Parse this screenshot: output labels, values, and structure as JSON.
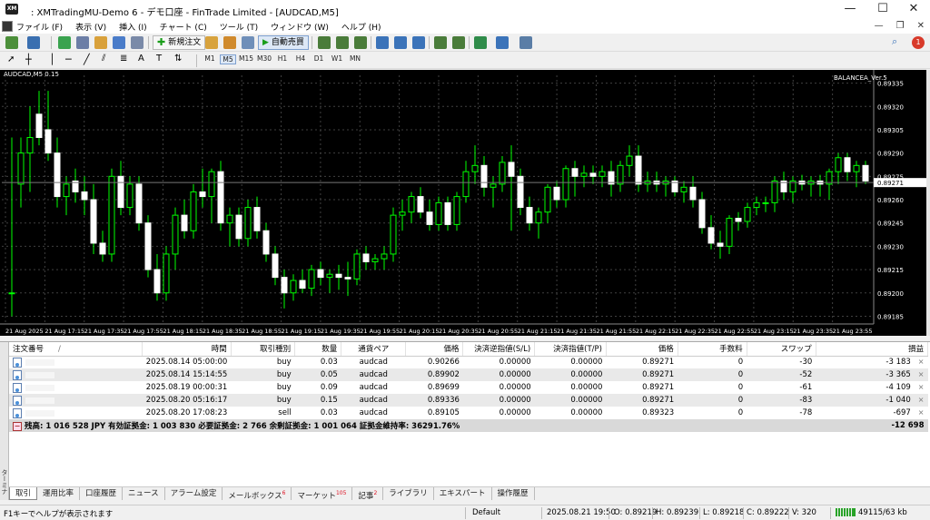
{
  "window": {
    "title": ": XMTradingMU-Demo 6 - デモ口座 - FinTrade Limited - [AUDCAD,M5]",
    "app_icon": "XM",
    "minimize": "—",
    "maximize": "☐",
    "close": "✕"
  },
  "menu": {
    "items": [
      "ファイル (F)",
      "表示 (V)",
      "挿入 (I)",
      "チャート (C)",
      "ツール (T)",
      "ウィンドウ (W)",
      "ヘルプ (H)"
    ],
    "right": [
      "—",
      "❐",
      "✕"
    ]
  },
  "toolbar": {
    "new_order_label": "新規注文",
    "auto_trade_label": "自動売買",
    "timeframes": [
      "M1",
      "M5",
      "M15",
      "M30",
      "H1",
      "H4",
      "D1",
      "W1",
      "MN"
    ],
    "notification_count": "1"
  },
  "chart": {
    "symbol_label": "AUDCAD,M5 0.15",
    "ea_label": "BALANCEA_Ver.5",
    "current_price": "0.89271",
    "colors": {
      "bg": "#000000",
      "bull": "#ffffff",
      "bear": "#00ff00",
      "grid": "#404040",
      "text": "#ffffff"
    }
  },
  "chart_data": {
    "type": "candlestick",
    "symbol": "AUDCAD",
    "timeframe": "M5",
    "ylim": [
      0.8918,
      0.8934
    ],
    "y_ticks": [
      "0.89335",
      "0.89320",
      "0.89305",
      "0.89290",
      "0.89275",
      "0.89260",
      "0.89245",
      "0.89230",
      "0.89215",
      "0.89200",
      "0.89185"
    ],
    "y_tick_values": [
      0.89335,
      0.8932,
      0.89305,
      0.8929,
      0.89275,
      0.8926,
      0.89245,
      0.8923,
      0.89215,
      0.892,
      0.89185
    ],
    "x_ticks": [
      "21 Aug 2025",
      "21 Aug 17:15",
      "21 Aug 17:35",
      "21 Aug 17:55",
      "21 Aug 18:15",
      "21 Aug 18:35",
      "21 Aug 18:55",
      "21 Aug 19:15",
      "21 Aug 19:35",
      "21 Aug 19:55",
      "21 Aug 20:15",
      "21 Aug 20:35",
      "21 Aug 20:55",
      "21 Aug 21:15",
      "21 Aug 21:35",
      "21 Aug 21:55",
      "21 Aug 22:15",
      "21 Aug 22:35",
      "21 Aug 22:55",
      "21 Aug 23:15",
      "21 Aug 23:35",
      "21 Aug 23:55"
    ],
    "bid_line": 0.89271,
    "grid": true,
    "candles": [
      {
        "o": 0.892,
        "h": 0.893,
        "l": 0.89185,
        "c": 0.892
      },
      {
        "o": 0.8927,
        "h": 0.893,
        "l": 0.89255,
        "c": 0.8929
      },
      {
        "o": 0.8929,
        "h": 0.8932,
        "l": 0.89265,
        "c": 0.893
      },
      {
        "o": 0.89315,
        "h": 0.8933,
        "l": 0.89295,
        "c": 0.893
      },
      {
        "o": 0.89305,
        "h": 0.8933,
        "l": 0.89285,
        "c": 0.8929
      },
      {
        "o": 0.8929,
        "h": 0.893,
        "l": 0.89255,
        "c": 0.89262
      },
      {
        "o": 0.89262,
        "h": 0.89275,
        "l": 0.8925,
        "c": 0.8927
      },
      {
        "o": 0.89272,
        "h": 0.8928,
        "l": 0.89258,
        "c": 0.89265
      },
      {
        "o": 0.89265,
        "h": 0.89275,
        "l": 0.8925,
        "c": 0.8926
      },
      {
        "o": 0.8926,
        "h": 0.8927,
        "l": 0.89225,
        "c": 0.89232
      },
      {
        "o": 0.89232,
        "h": 0.8924,
        "l": 0.8922,
        "c": 0.89225
      },
      {
        "o": 0.89225,
        "h": 0.8928,
        "l": 0.8922,
        "c": 0.89275
      },
      {
        "o": 0.89275,
        "h": 0.89285,
        "l": 0.8925,
        "c": 0.89255
      },
      {
        "o": 0.89255,
        "h": 0.89275,
        "l": 0.8925,
        "c": 0.8927
      },
      {
        "o": 0.8927,
        "h": 0.89275,
        "l": 0.8924,
        "c": 0.89245
      },
      {
        "o": 0.89245,
        "h": 0.8925,
        "l": 0.8921,
        "c": 0.89215
      },
      {
        "o": 0.89215,
        "h": 0.89225,
        "l": 0.89195,
        "c": 0.892
      },
      {
        "o": 0.892,
        "h": 0.8923,
        "l": 0.89195,
        "c": 0.89225
      },
      {
        "o": 0.89225,
        "h": 0.89255,
        "l": 0.89215,
        "c": 0.8925
      },
      {
        "o": 0.8925,
        "h": 0.8926,
        "l": 0.89235,
        "c": 0.8924
      },
      {
        "o": 0.8924,
        "h": 0.8927,
        "l": 0.89235,
        "c": 0.89265
      },
      {
        "o": 0.89265,
        "h": 0.8928,
        "l": 0.89255,
        "c": 0.89262
      },
      {
        "o": 0.89262,
        "h": 0.8928,
        "l": 0.89245,
        "c": 0.89278
      },
      {
        "o": 0.89278,
        "h": 0.89285,
        "l": 0.8924,
        "c": 0.89245
      },
      {
        "o": 0.89245,
        "h": 0.89255,
        "l": 0.8923,
        "c": 0.8925
      },
      {
        "o": 0.8925,
        "h": 0.89255,
        "l": 0.8923,
        "c": 0.89235
      },
      {
        "o": 0.89235,
        "h": 0.8926,
        "l": 0.8923,
        "c": 0.89255
      },
      {
        "o": 0.89255,
        "h": 0.89262,
        "l": 0.89235,
        "c": 0.8924
      },
      {
        "o": 0.8924,
        "h": 0.89245,
        "l": 0.8922,
        "c": 0.89225
      },
      {
        "o": 0.89225,
        "h": 0.8923,
        "l": 0.89205,
        "c": 0.8921
      },
      {
        "o": 0.8921,
        "h": 0.89215,
        "l": 0.8919,
        "c": 0.892
      },
      {
        "o": 0.892,
        "h": 0.89212,
        "l": 0.89195,
        "c": 0.89208
      },
      {
        "o": 0.89208,
        "h": 0.89215,
        "l": 0.892,
        "c": 0.89203
      },
      {
        "o": 0.89203,
        "h": 0.89218,
        "l": 0.89198,
        "c": 0.89215
      },
      {
        "o": 0.89215,
        "h": 0.8922,
        "l": 0.89205,
        "c": 0.8921
      },
      {
        "o": 0.8921,
        "h": 0.89215,
        "l": 0.892,
        "c": 0.89212
      },
      {
        "o": 0.89212,
        "h": 0.89218,
        "l": 0.89202,
        "c": 0.8921
      },
      {
        "o": 0.8921,
        "h": 0.8922,
        "l": 0.89198,
        "c": 0.89209
      },
      {
        "o": 0.89209,
        "h": 0.89228,
        "l": 0.89205,
        "c": 0.89225
      },
      {
        "o": 0.89225,
        "h": 0.8923,
        "l": 0.89215,
        "c": 0.8922
      },
      {
        "o": 0.8922,
        "h": 0.89225,
        "l": 0.89215,
        "c": 0.89222
      },
      {
        "o": 0.89222,
        "h": 0.8923,
        "l": 0.89215,
        "c": 0.89225
      },
      {
        "o": 0.89225,
        "h": 0.89255,
        "l": 0.8922,
        "c": 0.8925
      },
      {
        "o": 0.8925,
        "h": 0.8926,
        "l": 0.8924,
        "c": 0.89252
      },
      {
        "o": 0.89252,
        "h": 0.89265,
        "l": 0.89245,
        "c": 0.89262
      },
      {
        "o": 0.89262,
        "h": 0.89268,
        "l": 0.89248,
        "c": 0.89252
      },
      {
        "o": 0.89252,
        "h": 0.8926,
        "l": 0.8924,
        "c": 0.89244
      },
      {
        "o": 0.89244,
        "h": 0.89262,
        "l": 0.8924,
        "c": 0.89258
      },
      {
        "o": 0.89258,
        "h": 0.89262,
        "l": 0.8924,
        "c": 0.89244
      },
      {
        "o": 0.89244,
        "h": 0.89265,
        "l": 0.8924,
        "c": 0.89262
      },
      {
        "o": 0.89262,
        "h": 0.89285,
        "l": 0.89258,
        "c": 0.89278
      },
      {
        "o": 0.89278,
        "h": 0.89295,
        "l": 0.8927,
        "c": 0.89282
      },
      {
        "o": 0.89282,
        "h": 0.89288,
        "l": 0.89262,
        "c": 0.89268
      },
      {
        "o": 0.89268,
        "h": 0.89275,
        "l": 0.89255,
        "c": 0.8927
      },
      {
        "o": 0.8927,
        "h": 0.89288,
        "l": 0.89265,
        "c": 0.89284
      },
      {
        "o": 0.89284,
        "h": 0.89295,
        "l": 0.8924,
        "c": 0.89275
      },
      {
        "o": 0.89275,
        "h": 0.8928,
        "l": 0.8925,
        "c": 0.89255
      },
      {
        "o": 0.89255,
        "h": 0.89262,
        "l": 0.8924,
        "c": 0.89245
      },
      {
        "o": 0.89245,
        "h": 0.89255,
        "l": 0.89235,
        "c": 0.89252
      },
      {
        "o": 0.89252,
        "h": 0.8927,
        "l": 0.89245,
        "c": 0.89268
      },
      {
        "o": 0.89268,
        "h": 0.89272,
        "l": 0.89255,
        "c": 0.8926
      },
      {
        "o": 0.8926,
        "h": 0.89282,
        "l": 0.89255,
        "c": 0.8928
      },
      {
        "o": 0.8928,
        "h": 0.89285,
        "l": 0.89262,
        "c": 0.89275
      },
      {
        "o": 0.89275,
        "h": 0.89282,
        "l": 0.89268,
        "c": 0.89277
      },
      {
        "o": 0.89277,
        "h": 0.89282,
        "l": 0.8927,
        "c": 0.89275
      },
      {
        "o": 0.89275,
        "h": 0.89282,
        "l": 0.89268,
        "c": 0.89278
      },
      {
        "o": 0.89278,
        "h": 0.89285,
        "l": 0.89262,
        "c": 0.8927
      },
      {
        "o": 0.8927,
        "h": 0.89285,
        "l": 0.89265,
        "c": 0.89282
      },
      {
        "o": 0.89282,
        "h": 0.89295,
        "l": 0.89275,
        "c": 0.89288
      },
      {
        "o": 0.89288,
        "h": 0.89295,
        "l": 0.89265,
        "c": 0.8927
      },
      {
        "o": 0.8927,
        "h": 0.89278,
        "l": 0.89265,
        "c": 0.89272
      },
      {
        "o": 0.89272,
        "h": 0.89278,
        "l": 0.89265,
        "c": 0.8927
      },
      {
        "o": 0.8927,
        "h": 0.89275,
        "l": 0.89262,
        "c": 0.89272
      },
      {
        "o": 0.89272,
        "h": 0.89275,
        "l": 0.89262,
        "c": 0.89265
      },
      {
        "o": 0.89265,
        "h": 0.89272,
        "l": 0.89258,
        "c": 0.89268
      },
      {
        "o": 0.89268,
        "h": 0.89275,
        "l": 0.89255,
        "c": 0.8926
      },
      {
        "o": 0.8926,
        "h": 0.89265,
        "l": 0.89238,
        "c": 0.89242
      },
      {
        "o": 0.89242,
        "h": 0.8925,
        "l": 0.89228,
        "c": 0.89232
      },
      {
        "o": 0.89232,
        "h": 0.8924,
        "l": 0.89222,
        "c": 0.8923
      },
      {
        "o": 0.8923,
        "h": 0.8925,
        "l": 0.89225,
        "c": 0.89248
      },
      {
        "o": 0.89248,
        "h": 0.89252,
        "l": 0.8924,
        "c": 0.89246
      },
      {
        "o": 0.89246,
        "h": 0.89258,
        "l": 0.89242,
        "c": 0.89255
      },
      {
        "o": 0.89255,
        "h": 0.89262,
        "l": 0.8925,
        "c": 0.89258
      },
      {
        "o": 0.89258,
        "h": 0.89262,
        "l": 0.89252,
        "c": 0.89258
      },
      {
        "o": 0.89258,
        "h": 0.89275,
        "l": 0.89252,
        "c": 0.89272
      },
      {
        "o": 0.89272,
        "h": 0.89278,
        "l": 0.8926,
        "c": 0.89265
      },
      {
        "o": 0.89265,
        "h": 0.89275,
        "l": 0.89258,
        "c": 0.89272
      },
      {
        "o": 0.89272,
        "h": 0.89276,
        "l": 0.89266,
        "c": 0.8927
      },
      {
        "o": 0.8927,
        "h": 0.89275,
        "l": 0.89262,
        "c": 0.89272
      },
      {
        "o": 0.89272,
        "h": 0.89276,
        "l": 0.89262,
        "c": 0.8927
      },
      {
        "o": 0.8927,
        "h": 0.8928,
        "l": 0.8926,
        "c": 0.89278
      },
      {
        "o": 0.89278,
        "h": 0.8929,
        "l": 0.8927,
        "c": 0.89287
      },
      {
        "o": 0.89287,
        "h": 0.8929,
        "l": 0.89272,
        "c": 0.89278
      },
      {
        "o": 0.89278,
        "h": 0.89285,
        "l": 0.89268,
        "c": 0.89282
      },
      {
        "o": 0.89282,
        "h": 0.89285,
        "l": 0.8927,
        "c": 0.89272
      }
    ]
  },
  "terminal": {
    "side_label": "ターミナル",
    "columns": [
      "注文番号",
      "時間",
      "取引種別",
      "数量",
      "通貨ペア",
      "価格",
      "決済逆指値(S/L)",
      "決済指値(T/P)",
      "価格",
      "手数料",
      "スワップ",
      "損益"
    ],
    "sort_arrow": "/",
    "rows": [
      {
        "time": "2025.08.14 05:00:00",
        "type": "buy",
        "volume": "0.03",
        "symbol": "audcad",
        "price": "0.90266",
        "sl": "0.00000",
        "tp": "0.00000",
        "cur_price": "0.89271",
        "commission": "0",
        "swap": "-30",
        "profit": "-3 183"
      },
      {
        "time": "2025.08.14 15:14:55",
        "type": "buy",
        "volume": "0.05",
        "symbol": "audcad",
        "price": "0.89902",
        "sl": "0.00000",
        "tp": "0.00000",
        "cur_price": "0.89271",
        "commission": "0",
        "swap": "-52",
        "profit": "-3 365"
      },
      {
        "time": "2025.08.19 00:00:31",
        "type": "buy",
        "volume": "0.09",
        "symbol": "audcad",
        "price": "0.89699",
        "sl": "0.00000",
        "tp": "0.00000",
        "cur_price": "0.89271",
        "commission": "0",
        "swap": "-61",
        "profit": "-4 109"
      },
      {
        "time": "2025.08.20 05:16:17",
        "type": "buy",
        "volume": "0.15",
        "symbol": "audcad",
        "price": "0.89336",
        "sl": "0.00000",
        "tp": "0.00000",
        "cur_price": "0.89271",
        "commission": "0",
        "swap": "-83",
        "profit": "-1 040"
      },
      {
        "time": "2025.08.20 17:08:23",
        "type": "sell",
        "volume": "0.03",
        "symbol": "audcad",
        "price": "0.89105",
        "sl": "0.00000",
        "tp": "0.00000",
        "cur_price": "0.89323",
        "commission": "0",
        "swap": "-78",
        "profit": "-697"
      }
    ],
    "summary": "残高: 1 016 528 JPY  有効証拠金: 1 003 830  必要証拠金: 2 766  余剰証拠金: 1 001 064  証拠金維持率: 36291.76%",
    "summary_profit": "-12 698",
    "close_glyph": "×"
  },
  "tabs": [
    {
      "label": "取引",
      "badge": ""
    },
    {
      "label": "運用比率",
      "badge": ""
    },
    {
      "label": "口座履歴",
      "badge": ""
    },
    {
      "label": "ニュース",
      "badge": ""
    },
    {
      "label": "アラーム設定",
      "badge": ""
    },
    {
      "label": "メールボックス",
      "badge": "6"
    },
    {
      "label": "マーケット",
      "badge": "105"
    },
    {
      "label": "記事",
      "badge": "2"
    },
    {
      "label": "ライブラリ",
      "badge": ""
    },
    {
      "label": "エキスパート",
      "badge": ""
    },
    {
      "label": "操作履歴",
      "badge": ""
    }
  ],
  "status": {
    "help": "F1キーでヘルプが表示されます",
    "profile": "Default",
    "datetime": "2025.08.21 19:50",
    "open": "O: 0.89219",
    "high": "H: 0.89239",
    "low": "L: 0.89218",
    "close": "C: 0.89222",
    "volume": "V: 320",
    "traffic": "49115/63 kb"
  }
}
